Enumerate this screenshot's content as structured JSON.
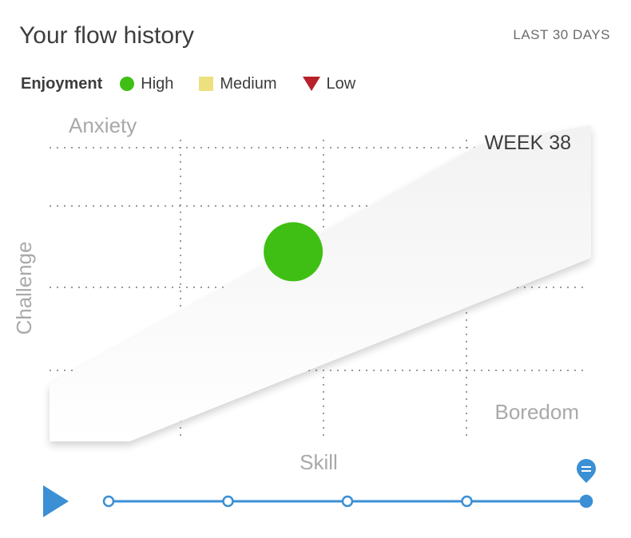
{
  "header": {
    "title": "Your flow history",
    "range": "LAST 30 DAYS"
  },
  "legend": {
    "label": "Enjoyment",
    "items": [
      {
        "label": "High",
        "color": "#3fbf14",
        "shape": "circle"
      },
      {
        "label": "Medium",
        "color": "#ede07e",
        "shape": "square"
      },
      {
        "label": "Low",
        "color": "#b82129",
        "shape": "triangle-down"
      }
    ]
  },
  "chart_data": {
    "type": "scatter",
    "title": "",
    "xlabel": "Skill",
    "ylabel": "Challenge",
    "xlim": [
      0,
      1
    ],
    "ylim": [
      0,
      1
    ],
    "grid": true,
    "zone_labels": {
      "top_left": "Anxiety",
      "bottom_right": "Boredom"
    },
    "period_label": "WEEK 38",
    "points": [
      {
        "x": 0.45,
        "y": 0.6,
        "enjoyment": "High"
      }
    ]
  },
  "timeline": {
    "play_icon": "play-icon",
    "marker_icon": "map-pin-icon",
    "stops": 5,
    "selected_index": 4,
    "accent": "#3b8fd4"
  }
}
